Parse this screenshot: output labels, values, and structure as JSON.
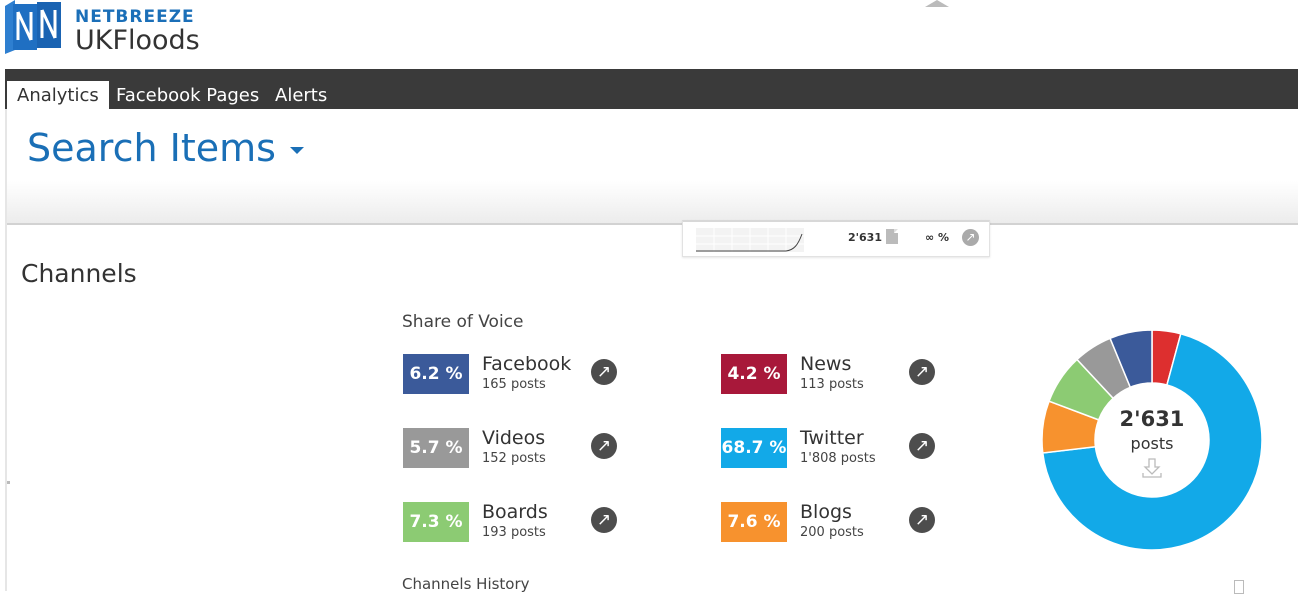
{
  "header": {
    "brand": "NETBREEZE",
    "project": "UKFloods"
  },
  "nav": {
    "tabs": [
      "Analytics",
      "Facebook Pages",
      "Alerts"
    ],
    "active": "Analytics"
  },
  "page": {
    "title": "Search Items"
  },
  "mini_panel": {
    "count": "2'631",
    "change": "∞ %"
  },
  "channels": {
    "section_title": "Channels",
    "share_title": "Share of Voice",
    "items": [
      {
        "name": "Facebook",
        "percent": "6.2 %",
        "posts": "165 posts",
        "color": "#3b5a9a"
      },
      {
        "name": "News",
        "percent": "4.2 %",
        "posts": "113 posts",
        "color": "#a8183a"
      },
      {
        "name": "Videos",
        "percent": "5.7 %",
        "posts": "152 posts",
        "color": "#999999"
      },
      {
        "name": "Twitter",
        "percent": "68.7 %",
        "posts": "1'808 posts",
        "color": "#12a9e8"
      },
      {
        "name": "Boards",
        "percent": "7.3 %",
        "posts": "193 posts",
        "color": "#8ccb73"
      },
      {
        "name": "Blogs",
        "percent": "7.6 %",
        "posts": "200 posts",
        "color": "#f7922e"
      }
    ],
    "donut": {
      "total": "2'631",
      "label": "posts",
      "slices": [
        {
          "name": "News",
          "value": 4.2,
          "color": "#dd2f2f"
        },
        {
          "name": "Twitter",
          "value": 68.7,
          "color": "#12a9e8"
        },
        {
          "name": "Blogs",
          "value": 7.6,
          "color": "#f7922e"
        },
        {
          "name": "Boards",
          "value": 7.3,
          "color": "#8ccb73"
        },
        {
          "name": "Videos",
          "value": 5.7,
          "color": "#999999"
        },
        {
          "name": "Facebook",
          "value": 6.2,
          "color": "#3b5a9a"
        }
      ]
    },
    "history_title": "Channels History"
  }
}
